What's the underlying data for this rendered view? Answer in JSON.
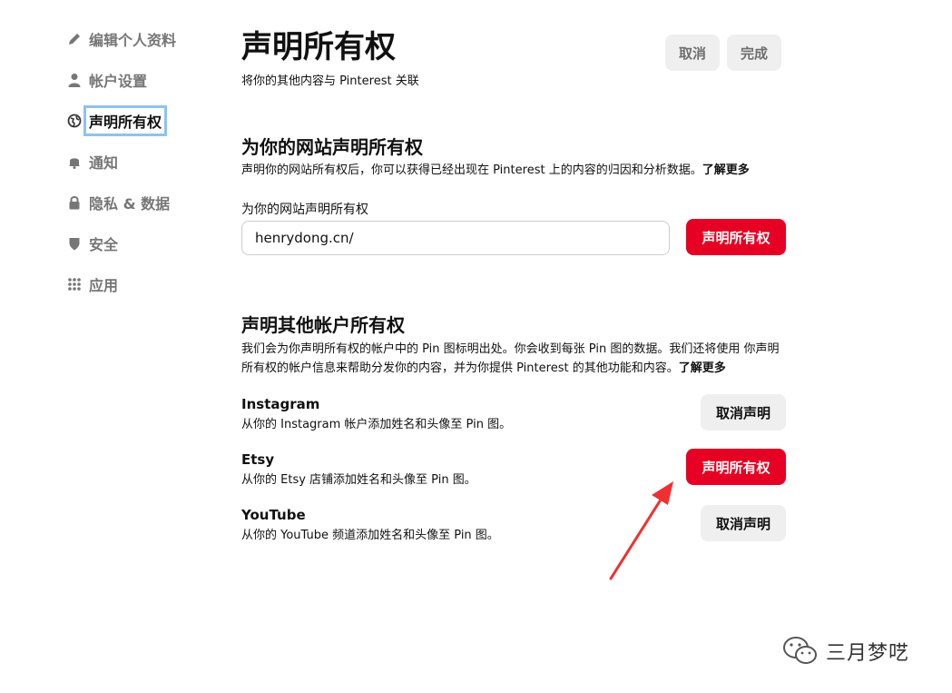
{
  "sidebar": {
    "items": [
      {
        "label": "编辑个人资料",
        "icon": "pencil-icon"
      },
      {
        "label": "帐户设置",
        "icon": "person-icon"
      },
      {
        "label": "声明所有权",
        "icon": "globe-icon",
        "active": true
      },
      {
        "label": "通知",
        "icon": "bell-icon"
      },
      {
        "label": "隐私 & 数据",
        "icon": "lock-icon"
      },
      {
        "label": "安全",
        "icon": "shield-icon"
      },
      {
        "label": "应用",
        "icon": "grid-icon"
      }
    ]
  },
  "header": {
    "title": "声明所有权",
    "subtitle": "将你的其他内容与 Pinterest 关联",
    "cancel_label": "取消",
    "done_label": "完成"
  },
  "website_section": {
    "title": "为你的网站声明所有权",
    "description": "声明你的网站所有权后，你可以获得已经出现在 Pinterest 上的内容的归因和分析数据。",
    "learn_more": "了解更多",
    "field_label": "为你的网站声明所有权",
    "input_value": "henrydong.cn/",
    "claim_button": "声明所有权"
  },
  "accounts_section": {
    "title": "声明其他帐户所有权",
    "description": "我们会为你声明所有权的帐户中的 Pin 图标明出处。你会收到每张 Pin 图的数据。我们还将使用 你声明所有权的帐户信息来帮助分发你的内容，并为你提供 Pinterest 的其他功能和内容。",
    "learn_more": "了解更多",
    "accounts": [
      {
        "name": "Instagram",
        "description": "从你的 Instagram 帐户添加姓名和头像至 Pin 图。",
        "button": "取消声明"
      },
      {
        "name": "Etsy",
        "description": "从你的 Etsy 店铺添加姓名和头像至 Pin 图。",
        "button": "声明所有权"
      },
      {
        "name": "YouTube",
        "description": "从你的 YouTube 频道添加姓名和头像至 Pin 图。",
        "button": "取消声明"
      }
    ]
  },
  "watermark": {
    "text": "三月梦呓"
  },
  "colors": {
    "accent": "#e60023",
    "focus_outline": "#8ec2f0",
    "arrow": "#f03030"
  }
}
